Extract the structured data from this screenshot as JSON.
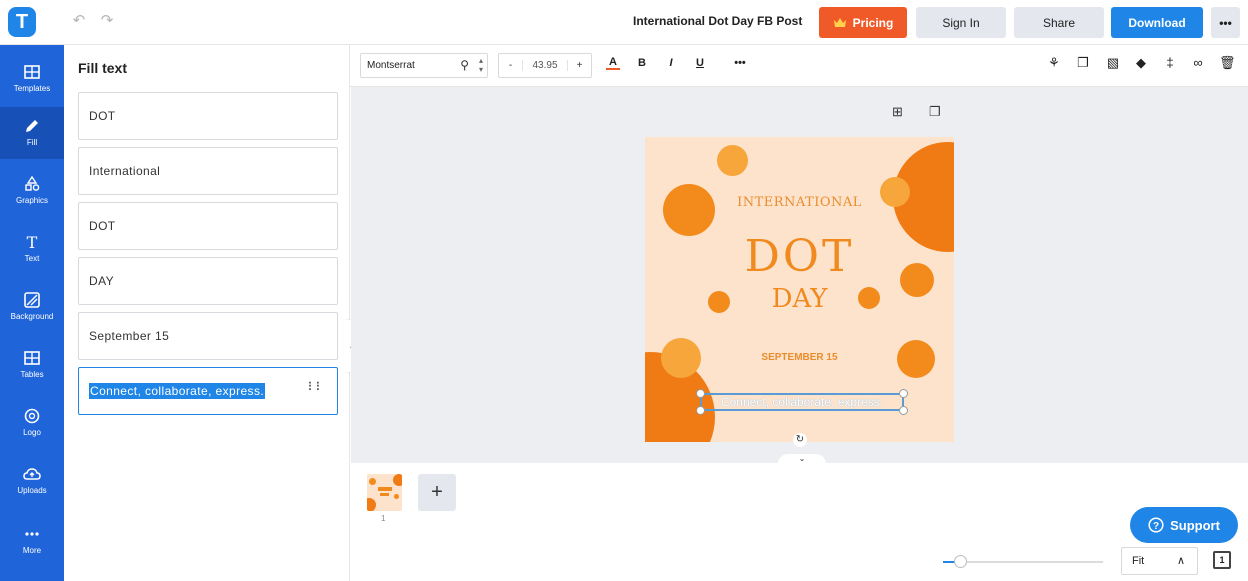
{
  "app": {
    "logo_letter": "T",
    "document_title": "International Dot Day FB Post"
  },
  "topbar": {
    "pricing_label": "Pricing",
    "signin_label": "Sign In",
    "share_label": "Share",
    "download_label": "Download",
    "more_label": "•••"
  },
  "rail": {
    "items": [
      {
        "label": "Templates",
        "icon": "templates-icon"
      },
      {
        "label": "Fill",
        "icon": "pencil-icon"
      },
      {
        "label": "Graphics",
        "icon": "shapes-icon"
      },
      {
        "label": "Text",
        "icon": "text-icon"
      },
      {
        "label": "Background",
        "icon": "background-icon"
      },
      {
        "label": "Tables",
        "icon": "table-icon"
      },
      {
        "label": "Logo",
        "icon": "logo-icon"
      },
      {
        "label": "Uploads",
        "icon": "cloud-upload-icon"
      },
      {
        "label": "More",
        "icon": "more-icon"
      }
    ]
  },
  "panel": {
    "title": "Fill text",
    "fields": [
      "DOT",
      "International",
      "DOT",
      "DAY",
      "September 15",
      "Connect, collaborate, express."
    ],
    "active_field_index": 5
  },
  "format_toolbar": {
    "font_family": "Montserrat",
    "font_size": "43.95",
    "decrease": "-",
    "increase": "+",
    "color_letter": "A",
    "bold": "B",
    "italic": "I",
    "underline": "U",
    "more": "•••"
  },
  "design": {
    "line_international": "INTERNATIONAL",
    "line_dot": "DOT",
    "line_day": "DAY",
    "line_date": "SEPTEMBER 15",
    "line_tagline": "Connect, collaborate, express.",
    "colors": {
      "background": "#fde3cc",
      "orange": "#f28b1c",
      "light_orange": "#f7a63b",
      "selection": "#5b9bd5"
    }
  },
  "pages": {
    "thumb_number": "1",
    "add_label": "+"
  },
  "bottom": {
    "support_label": "Support",
    "zoom_label": "Fit",
    "page_count": "1"
  },
  "colors": {
    "accent": "#1f86e8",
    "rail": "#1f64d9",
    "pricing": "#f05a28"
  }
}
